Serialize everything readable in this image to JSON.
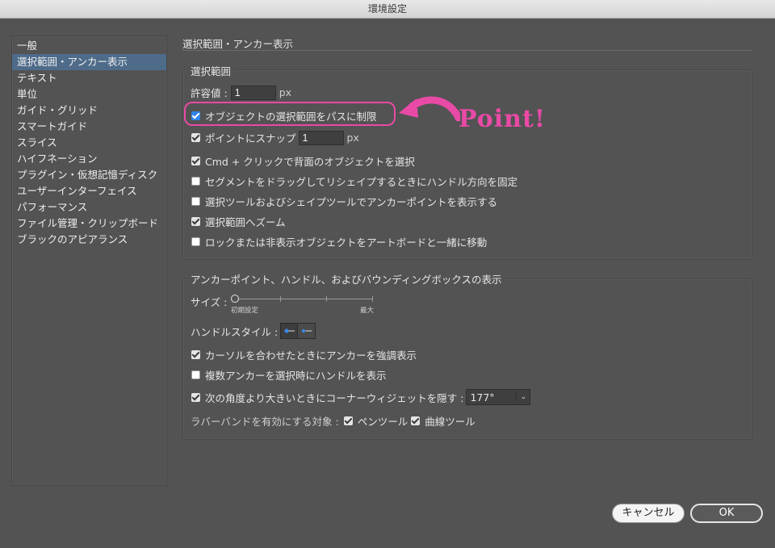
{
  "window": {
    "title": "環境設定"
  },
  "sidebar": {
    "items": [
      {
        "label": "一般",
        "selected": false
      },
      {
        "label": "選択範囲・アンカー表示",
        "selected": true
      },
      {
        "label": "テキスト",
        "selected": false
      },
      {
        "label": "単位",
        "selected": false
      },
      {
        "label": "ガイド・グリッド",
        "selected": false
      },
      {
        "label": "スマートガイド",
        "selected": false
      },
      {
        "label": "スライス",
        "selected": false
      },
      {
        "label": "ハイフネーション",
        "selected": false
      },
      {
        "label": "プラグイン・仮想記憶ディスク",
        "selected": false
      },
      {
        "label": "ユーザーインターフェイス",
        "selected": false
      },
      {
        "label": "パフォーマンス",
        "selected": false
      },
      {
        "label": "ファイル管理・クリップボード",
        "selected": false
      },
      {
        "label": "ブラックのアピアランス",
        "selected": false
      }
    ]
  },
  "page": {
    "title": "選択範囲・アンカー表示"
  },
  "selection_group": {
    "label": "選択範囲",
    "tolerance_label": "許容値 :",
    "tolerance_value": "1",
    "tolerance_unit": "px",
    "options": [
      {
        "label": "オブジェクトの選択範囲をパスに制限",
        "checked": true
      },
      {
        "label": "ポイントにスナップ",
        "checked": true
      },
      {
        "label": "Cmd + クリックで背面のオブジェクトを選択",
        "checked": true
      },
      {
        "label": "セグメントをドラッグしてリシェイプするときにハンドル方向を固定",
        "checked": false
      },
      {
        "label": "選択ツールおよびシェイプツールでアンカーポイントを表示する",
        "checked": false
      },
      {
        "label": "選択範囲へズーム",
        "checked": true
      },
      {
        "label": "ロックまたは非表示オブジェクトをアートボードと一緒に移動",
        "checked": false
      }
    ],
    "snap_value": "1",
    "snap_unit": "px"
  },
  "anchor_group": {
    "label": "アンカーポイント、ハンドル、およびバウンディングボックスの表示",
    "size_label": "サイズ :",
    "size_min_label": "初期設定",
    "size_max_label": "最大",
    "size_level": 0,
    "handle_style_label": "ハンドルスタイル :",
    "options": [
      {
        "label": "カーソルを合わせたときにアンカーを強調表示",
        "checked": true
      },
      {
        "label": "複数アンカーを選択時にハンドルを表示",
        "checked": false
      },
      {
        "label": "次の角度より大きいときにコーナーウィジェットを隠す :",
        "checked": true
      }
    ],
    "angle_value": "177°",
    "rubber_band_label": "ラバーバンドを有効にする対象 :",
    "pen_tool_label": "ペンツール",
    "pen_tool_checked": true,
    "curvature_tool_label": "曲線ツール",
    "curvature_tool_checked": true
  },
  "annotation": {
    "text": "Point!",
    "color": "#e84aa6"
  },
  "buttons": {
    "cancel": "キャンセル",
    "ok": "OK"
  }
}
